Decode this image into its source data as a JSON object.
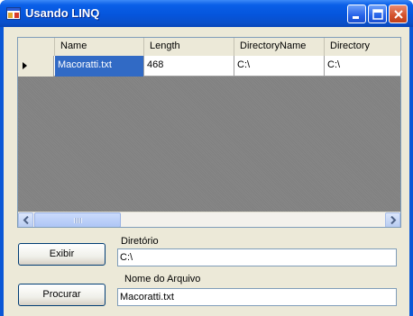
{
  "window": {
    "title": "Usando LINQ",
    "accent": "#0a57d6"
  },
  "grid": {
    "columns": [
      "Name",
      "Length",
      "DirectoryName",
      "Directory"
    ],
    "rows": [
      {
        "name": "Macoratti.txt",
        "length": "468",
        "directory_name": "C:\\",
        "directory": "C:\\"
      }
    ],
    "selection_color": "#316ac5",
    "grip_label": "III"
  },
  "controls": {
    "exibir_label": "Exibir",
    "procurar_label": "Procurar",
    "diretorio_label": "Diretório",
    "diretorio_value": "C:\\",
    "nome_arquivo_label": "Nome do Arquivo",
    "nome_arquivo_value": "Macoratti.txt"
  },
  "icons": {
    "app": "app-window-icon",
    "minimize": "minimize-icon",
    "maximize": "maximize-icon",
    "close": "close-icon",
    "scroll_left": "arrow-left-icon",
    "scroll_right": "arrow-right-icon",
    "row_indicator": "row-pointer-icon"
  }
}
